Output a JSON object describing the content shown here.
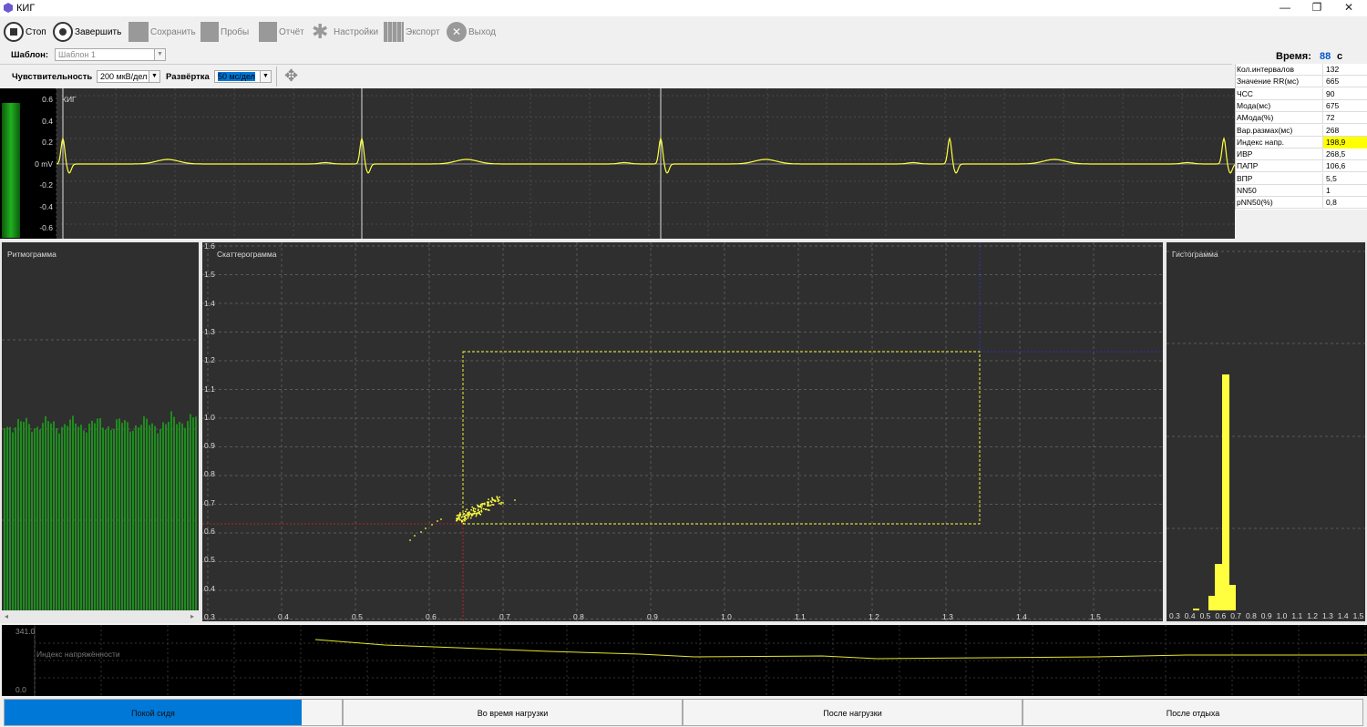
{
  "window": {
    "title": "КИГ",
    "min": "—",
    "max": "❐",
    "close": "✕"
  },
  "toolbar": {
    "stop": "Стоп",
    "finish": "Завершить",
    "save": "Сохранить",
    "samples": "Пробы",
    "report": "Отчёт",
    "settings": "Настройки",
    "export": "Экспорт",
    "exit": "Выход"
  },
  "template": {
    "label": "Шаблон:",
    "value": "Шаблон 1"
  },
  "time": {
    "label": "Время:",
    "value": "88",
    "unit": "с"
  },
  "controls": {
    "sensitivity_label": "Чувствительность",
    "sensitivity_value": "200 мкВ/дел",
    "sweep_label": "Развёртка",
    "sweep_value": "50 мс/дел"
  },
  "ecg": {
    "title": "КИГ",
    "y_ticks": [
      "0.6",
      "0.4",
      "0.2",
      "0 mV",
      "-0.2",
      "-0.4",
      "-0.6"
    ]
  },
  "params": [
    {
      "k": "Кол.интервалов",
      "v": "132"
    },
    {
      "k": "Значение RR(мс)",
      "v": "665"
    },
    {
      "k": "ЧСС",
      "v": "90"
    },
    {
      "k": "Мода(мс)",
      "v": "675"
    },
    {
      "k": "АМода(%)",
      "v": "72"
    },
    {
      "k": "Вар.размах(мс)",
      "v": "268"
    },
    {
      "k": "Индекс напр.",
      "v": "198,9",
      "highlight": "#ffff00"
    },
    {
      "k": "ИВР",
      "v": "268,5"
    },
    {
      "k": "ПАПР",
      "v": "106,6"
    },
    {
      "k": "ВПР",
      "v": "5,5"
    },
    {
      "k": "NN50",
      "v": "1"
    },
    {
      "k": "pNN50(%)",
      "v": "0,8"
    }
  ],
  "rhythmogram": {
    "title": "Ритмограмма"
  },
  "scattergram": {
    "title": "Скаттерограмма",
    "y_ticks": [
      "1.6",
      "1.5",
      "1.4",
      "1.3",
      "1.2",
      "1.1",
      "1.0",
      "0.9",
      "0.8",
      "0.7",
      "0.6",
      "0.5",
      "0.4",
      "0.3"
    ],
    "x_ticks": [
      "0.4",
      "0.5",
      "0.6",
      "0.7",
      "0.8",
      "0.9",
      "1.0",
      "1.1",
      "1.2",
      "1.3",
      "1.4",
      "1.5"
    ]
  },
  "histogram": {
    "title": "Гистограмма",
    "x_ticks": [
      "0.3",
      "0.4",
      "0.5",
      "0.6",
      "0.7",
      "0.8",
      "0.9",
      "1.0",
      "1.1",
      "1.2",
      "1.3",
      "1.4",
      "1.5"
    ]
  },
  "stress": {
    "label": "Индекс напряжённости",
    "y_max": "341.0",
    "y_min": "0.0"
  },
  "tabs": [
    "Покой сидя",
    "Во время нагрузки",
    "После нагрузки",
    "После отдыха"
  ],
  "colors": {
    "signal": "#ffff40",
    "panel": "#2f2f2f",
    "accent": "#0078d7",
    "rhythm": "#1e8c1e"
  }
}
